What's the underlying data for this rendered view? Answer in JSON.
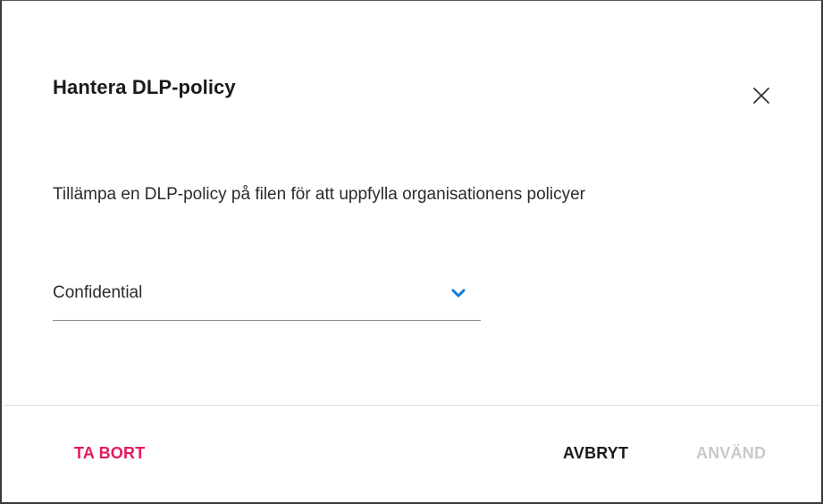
{
  "dialog": {
    "title": "Hantera DLP-policy",
    "description": "Tillämpa en DLP-policy på filen för att uppfylla organisationens policyer",
    "close_icon": "close-icon"
  },
  "policy_select": {
    "value": "Confidential",
    "icon": "chevron-down-icon",
    "icon_color": "#0a7bd8"
  },
  "footer": {
    "remove_label": "TA BORT",
    "cancel_label": "AVBRYT",
    "apply_label": "ANVÄND",
    "apply_disabled": true
  },
  "colors": {
    "remove": "#e6195a",
    "apply_disabled": "#c9c9c9",
    "text": "#1a1a1a"
  }
}
